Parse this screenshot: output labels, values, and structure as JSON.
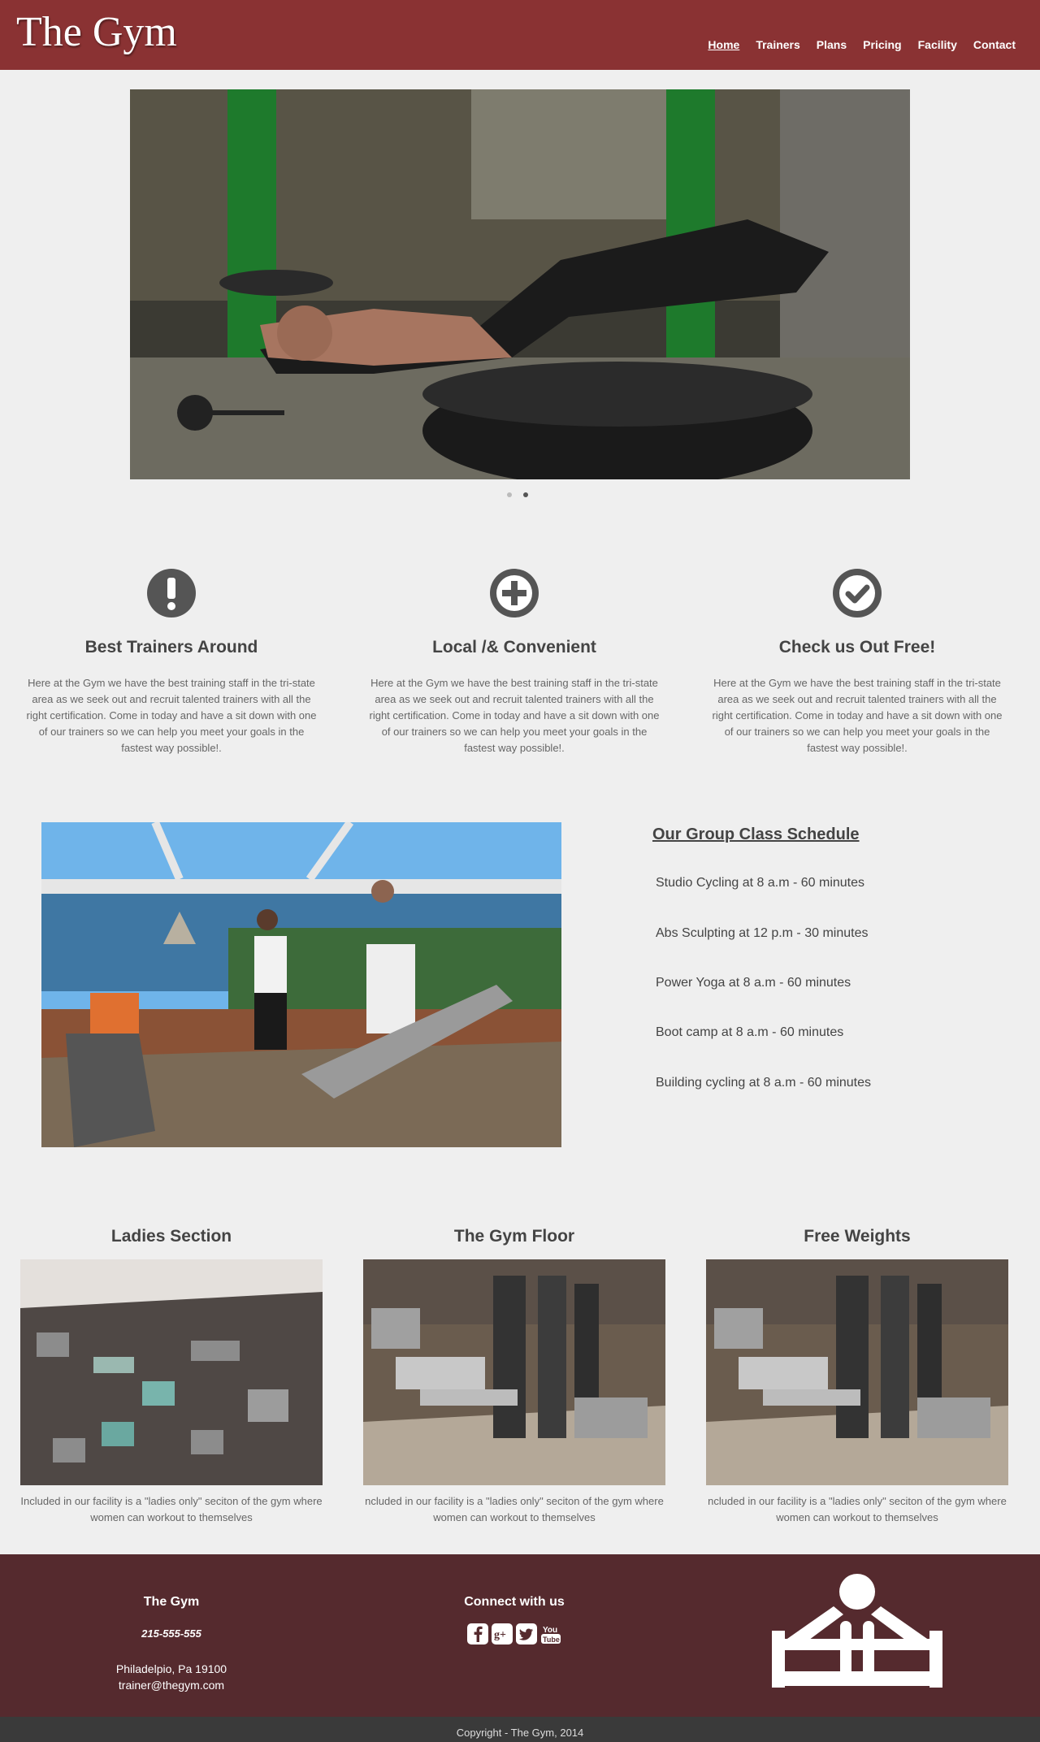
{
  "header": {
    "brand": "The Gym",
    "nav": [
      "Home",
      "Trainers",
      "Plans",
      "Pricing",
      "Facility",
      "Contact"
    ]
  },
  "features": [
    {
      "title": "Best Trainers Around",
      "icon": "exclamation-icon",
      "text": "Here at the Gym we have the best training staff in the tri-state area as we seek out and recruit talented trainers with all the right certification. Come in today and have a sit down with one of our trainers so we can help you meet your goals in the fastest way possible!."
    },
    {
      "title": "Local /& Convenient",
      "icon": "plus-icon",
      "text": "Here at the Gym we have the best training staff in the tri-state area as we seek out and recruit talented trainers with all the right certification. Come in today and have a sit down with one of our trainers so we can help you meet your goals in the fastest way possible!."
    },
    {
      "title": "Check us Out Free!",
      "icon": "check-icon",
      "text": "Here at the Gym we have the best training staff in the tri-state area as we seek out and recruit talented trainers with all the right certification. Come in today and have a sit down with one of our trainers so we can help you meet your goals in the fastest way possible!."
    }
  ],
  "schedule": {
    "title": "Our Group Class Schedule",
    "items": [
      "Studio Cycling at 8 a.m - 60 minutes",
      "Abs Sculpting at 12 p.m - 30 minutes",
      "Power Yoga at 8 a.m - 60 minutes",
      "Boot camp at 8 a.m - 60 minutes",
      "Building cycling at 8 a.m - 60 minutes"
    ]
  },
  "gallery": [
    {
      "title": "Ladies Section",
      "caption": "Included in our facility is a \"ladies only\" seciton of the gym where women can workout to themselves"
    },
    {
      "title": "The Gym Floor",
      "caption": "ncluded in our facility is a \"ladies only\" seciton of the gym where women can workout to themselves"
    },
    {
      "title": "Free Weights",
      "caption": "ncluded in our facility is a \"ladies only\" seciton of the gym where women can workout to themselves"
    }
  ],
  "footer": {
    "name": "The Gym",
    "phone": "215-555-555",
    "address": "Philadelpio, Pa 19100",
    "email": "trainer@thegym.com",
    "connect": "Connect with us",
    "social": [
      "facebook-icon",
      "google-plus-icon",
      "twitter-icon",
      "youtube-icon"
    ],
    "copyright": "Copyright - The Gym, 2014"
  },
  "colors": {
    "header": "#8a3233",
    "footer": "#552a2e",
    "copybar": "#3a3a3a"
  }
}
